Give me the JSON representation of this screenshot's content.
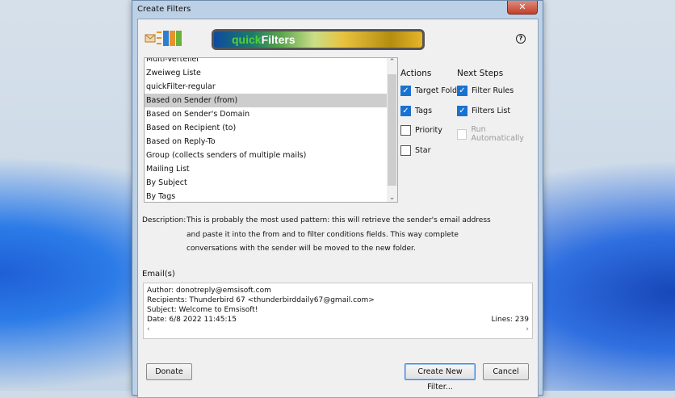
{
  "window": {
    "title": "Create Filters",
    "close": "✕"
  },
  "banner": {
    "prefix": "quick",
    "suffix": "Filters",
    "help": "?"
  },
  "templates": [
    "Multi-Verteiler",
    "Zweiweg Liste",
    "quickFilter-regular",
    "Based on Sender (from)",
    "Based on Sender's Domain",
    "Based on Recipient (to)",
    "Based on Reply-To",
    "Group (collects senders of multiple mails)",
    "Mailing List",
    "By Subject",
    "By Tags"
  ],
  "selected_index": 3,
  "actions": {
    "header": "Actions",
    "items": [
      {
        "label": "Target Folder",
        "checked": true
      },
      {
        "label": "Tags",
        "checked": true
      },
      {
        "label": "Priority",
        "checked": false
      },
      {
        "label": "Star",
        "checked": false
      }
    ]
  },
  "next_steps": {
    "header": "Next Steps",
    "items": [
      {
        "label": "Filter Rules",
        "checked": true
      },
      {
        "label": "Filters List",
        "checked": true
      },
      {
        "label": "Run Automatically",
        "checked": false,
        "disabled": true
      }
    ]
  },
  "description": {
    "label": "Description:",
    "text": "This is probably the most used pattern: this will retrieve the sender's email address and paste it into the from and to filter conditions fields. This way complete conversations with the sender will be moved to the new folder."
  },
  "emails": {
    "label": "Email(s)",
    "author": "Author:  donotreply@emsisoft.com",
    "recipients": "Recipients:  Thunderbird 67 <thunderbirddaily67@gmail.com>",
    "subject": "Subject:  Welcome to Emsisoft!",
    "date": "Date:  6/8 2022 11:45:15",
    "lines": "Lines:  239"
  },
  "buttons": {
    "donate": "Donate",
    "create": "Create New Filter...",
    "cancel": "Cancel"
  }
}
